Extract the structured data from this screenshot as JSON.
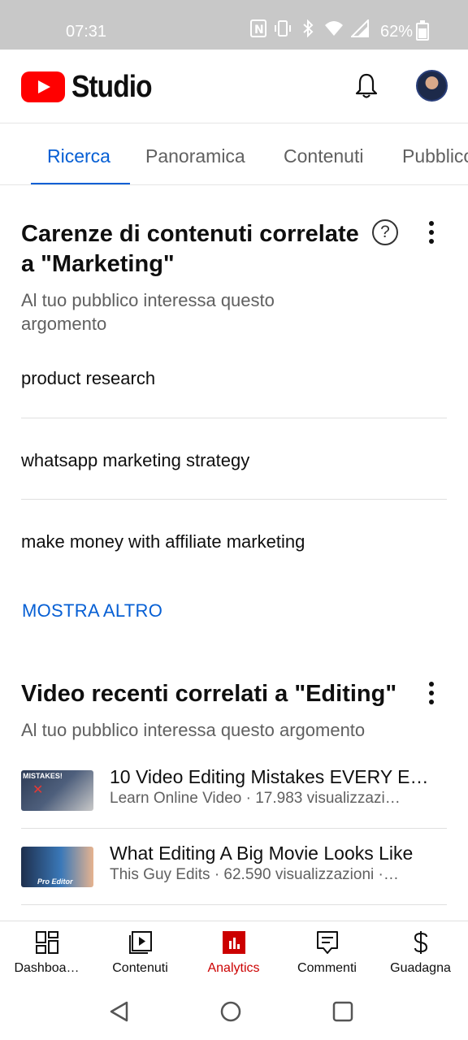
{
  "status_bar": {
    "time": "07:31",
    "battery_percent": "62%",
    "icons": [
      "nfc-icon",
      "vibrate-icon",
      "bluetooth-icon",
      "wifi-icon",
      "signal-icon",
      "battery-icon"
    ]
  },
  "header": {
    "logo_text": "Studio",
    "brand_color": "#ff0000"
  },
  "tabs": [
    {
      "label": "Ricerca",
      "active": true
    },
    {
      "label": "Panoramica",
      "active": false
    },
    {
      "label": "Contenuti",
      "active": false
    },
    {
      "label": "Pubblico",
      "active": false
    }
  ],
  "card1": {
    "title": "Carenze di contenuti correlate a \"Marketing\"",
    "subtitle": "Al tuo pubblico interessa questo argomento",
    "items": [
      "product research",
      "whatsapp marketing strategy",
      "make money with affiliate marketing"
    ],
    "more_label": "MOSTRA ALTRO"
  },
  "card2": {
    "title": "Video recenti correlati a \"Editing\"",
    "subtitle": "Al tuo pubblico interessa questo argomento",
    "videos": [
      {
        "title": "10 Video Editing Mistakes EVERY E…",
        "meta": "Learn Online Video · 17.983 visualizzazi…",
        "thumb_text": "MISTAKES!"
      },
      {
        "title": "What Editing A Big Movie Looks Like",
        "meta": "This Guy Edits · 62.590 visualizzazioni ·…",
        "thumb_text": "Pro Editor"
      }
    ]
  },
  "bottom_nav": [
    {
      "label": "Dashboa…",
      "icon": "dashboard-icon",
      "active": false
    },
    {
      "label": "Contenuti",
      "icon": "content-icon",
      "active": false
    },
    {
      "label": "Analytics",
      "icon": "analytics-icon",
      "active": true
    },
    {
      "label": "Commenti",
      "icon": "comments-icon",
      "active": false
    },
    {
      "label": "Guadagna",
      "icon": "earn-icon",
      "active": false
    }
  ],
  "colors": {
    "accent": "#065fd4",
    "active_nav": "#cc0000"
  }
}
